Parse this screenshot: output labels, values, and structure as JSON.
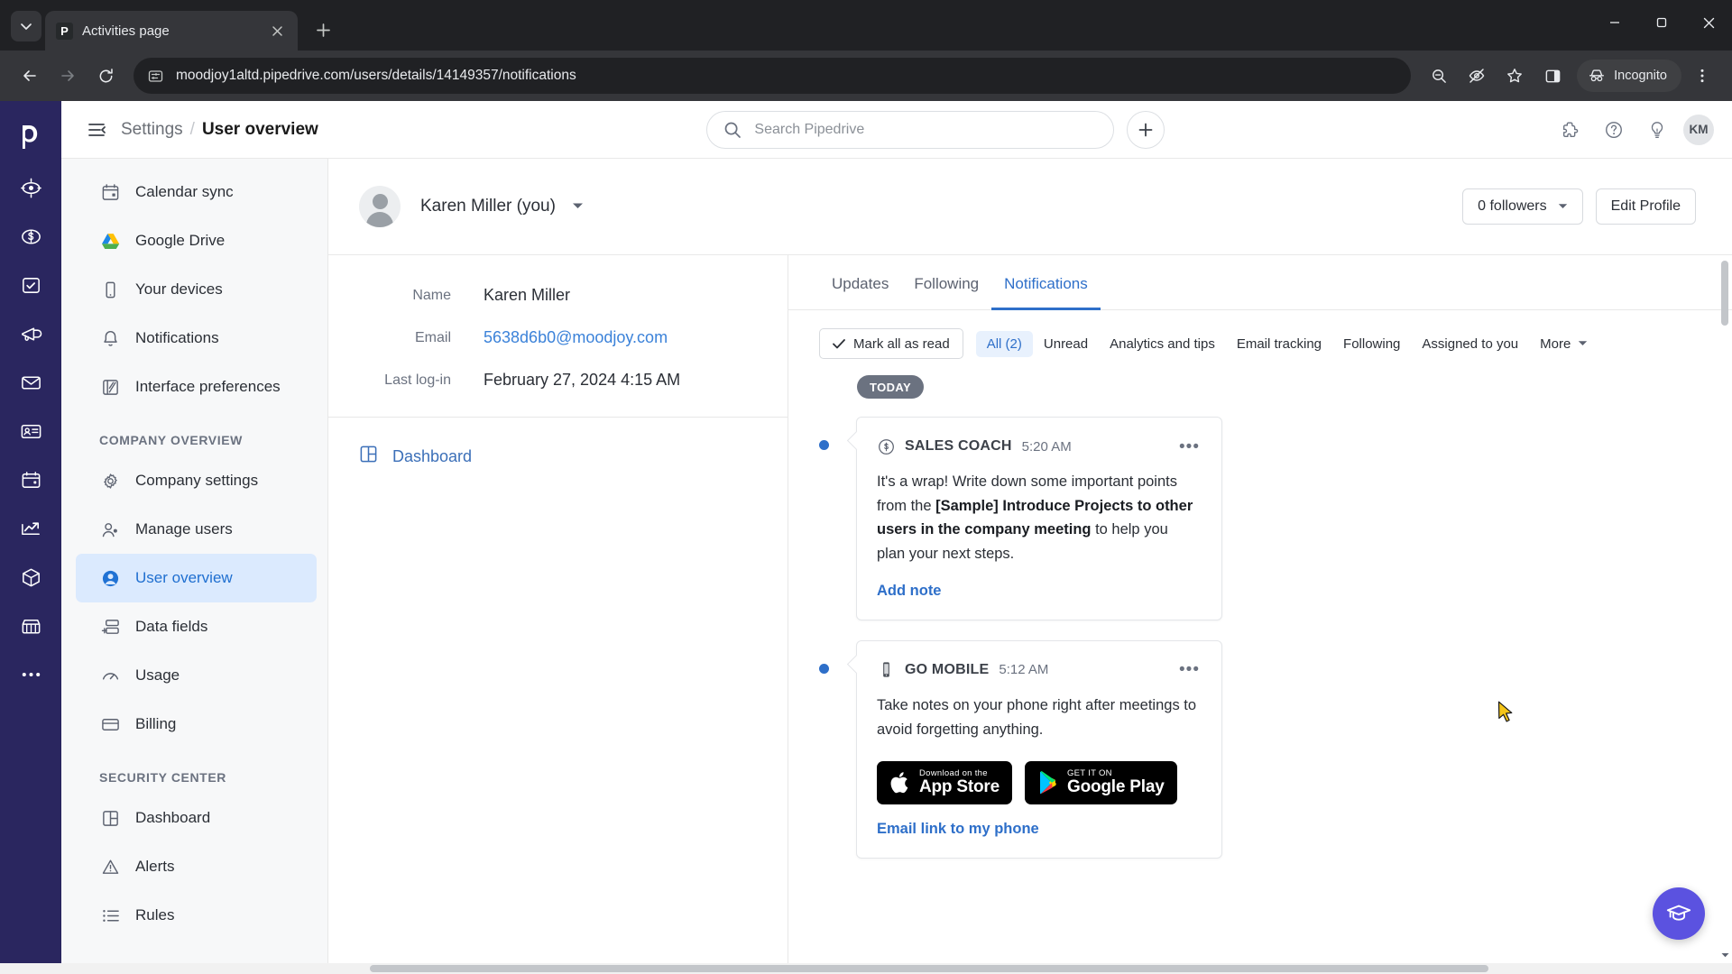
{
  "browser": {
    "tab": {
      "title": "Activities page",
      "favicon_letter": "P"
    },
    "url": "moodjoy1altd.pipedrive.com/users/details/14149357/notifications",
    "profile_label": "Incognito",
    "icons": {
      "tab_search": "tab-search-dropdown-icon",
      "new_tab": "new-tab-icon",
      "minimize": "minimize-icon",
      "maximize": "maximize-icon",
      "close": "close-window-icon",
      "back": "back-icon",
      "forward": "forward-icon",
      "reload": "reload-icon",
      "site_info": "site-settings-icon",
      "zoom_out": "zoom-out-icon",
      "hide_password": "eye-slash-icon",
      "bookmark": "star-icon",
      "side_panel": "side-panel-icon",
      "menu": "three-dot-menu-icon"
    }
  },
  "rail": {
    "logo": "pipedrive-logo",
    "items": [
      {
        "name": "leads-icon"
      },
      {
        "name": "deals-icon"
      },
      {
        "name": "activities-icon"
      },
      {
        "name": "campaigns-icon"
      },
      {
        "name": "mail-icon"
      },
      {
        "name": "contacts-icon"
      },
      {
        "name": "calendar-icon"
      },
      {
        "name": "insights-icon"
      },
      {
        "name": "products-icon"
      },
      {
        "name": "marketplace-icon"
      },
      {
        "name": "more-icon"
      }
    ]
  },
  "topbar": {
    "hamburger": "collapse-menu-icon",
    "breadcrumb_parent": "Settings",
    "breadcrumb_sep": "/",
    "breadcrumb_current": "User overview",
    "search_placeholder": "Search Pipedrive",
    "add_button": "add-new-icon",
    "right_icons": [
      "apps-icon",
      "help-icon",
      "whats-new-icon"
    ],
    "avatar_initials": "KM"
  },
  "settings_nav": {
    "items": [
      {
        "label": "Calendar sync",
        "icon": "calendar-sync-icon",
        "active": false
      },
      {
        "label": "Google Drive",
        "icon": "google-drive-icon",
        "active": false
      },
      {
        "label": "Your devices",
        "icon": "device-icon",
        "active": false
      },
      {
        "label": "Notifications",
        "icon": "bell-icon",
        "active": false
      },
      {
        "label": "Interface preferences",
        "icon": "interface-preferences-icon",
        "active": false
      }
    ],
    "section_company": "COMPANY OVERVIEW",
    "company_items": [
      {
        "label": "Company settings",
        "icon": "gear-icon",
        "active": false
      },
      {
        "label": "Manage users",
        "icon": "users-icon",
        "active": false
      },
      {
        "label": "User overview",
        "icon": "user-circle-icon",
        "active": true
      },
      {
        "label": "Data fields",
        "icon": "data-fields-icon",
        "active": false
      },
      {
        "label": "Usage",
        "icon": "usage-gauge-icon",
        "active": false
      },
      {
        "label": "Billing",
        "icon": "credit-card-icon",
        "active": false
      }
    ],
    "section_security": "SECURITY CENTER",
    "security_items": [
      {
        "label": "Dashboard",
        "icon": "dashboard-grid-icon",
        "active": false
      },
      {
        "label": "Alerts",
        "icon": "warning-triangle-icon",
        "active": false
      },
      {
        "label": "Rules",
        "icon": "list-rules-icon",
        "active": false
      }
    ]
  },
  "profile": {
    "display_name": "Karen Miller (you)",
    "avatar": "user-avatar-placeholder",
    "followers_label": "0 followers",
    "edit_label": "Edit Profile"
  },
  "details": {
    "rows": [
      {
        "label": "Name",
        "value": "Karen Miller",
        "is_link": false
      },
      {
        "label": "Email",
        "value": "5638d6b0@moodjoy.com",
        "is_link": true
      },
      {
        "label": "Last log-in",
        "value": "February 27, 2024 4:15 AM",
        "is_link": false
      }
    ],
    "dashboard_link": "Dashboard"
  },
  "feed": {
    "tabs": [
      {
        "label": "Updates",
        "active": false
      },
      {
        "label": "Following",
        "active": false
      },
      {
        "label": "Notifications",
        "active": true
      }
    ],
    "mark_all_read": "Mark all as read",
    "filters": [
      {
        "label": "All (2)",
        "active": true
      },
      {
        "label": "Unread",
        "active": false
      },
      {
        "label": "Analytics and tips",
        "active": false
      },
      {
        "label": "Email tracking",
        "active": false
      },
      {
        "label": "Following",
        "active": false
      },
      {
        "label": "Assigned to you",
        "active": false
      }
    ],
    "more_label": "More",
    "day_badge": "TODAY",
    "notifications": [
      {
        "source": "SALES COACH",
        "source_icon": "sales-coach-icon",
        "time": "5:20 AM",
        "unread": true,
        "body_pre": "It's a wrap! Write down some important points from the ",
        "body_bold": "[Sample] Introduce Projects to other users in the company meeting",
        "body_post": " to help you plan your next steps.",
        "action": "Add note"
      },
      {
        "source": "GO MOBILE",
        "source_icon": "mobile-phone-icon",
        "time": "5:12 AM",
        "unread": true,
        "body_pre": "Take notes on your phone right after meetings to avoid forgetting anything.",
        "body_bold": "",
        "body_post": "",
        "action": "Email link to my phone",
        "store_badges": [
          {
            "small": "Download on the",
            "big": "App Store",
            "icon": "apple-logo-icon"
          },
          {
            "small": "GET IT ON",
            "big": "Google Play",
            "icon": "google-play-icon"
          }
        ]
      }
    ]
  },
  "fab": {
    "name": "academy-graduation-cap-icon"
  },
  "colors": {
    "rail_bg": "#2a265f",
    "accent_blue": "#2e6fc9",
    "active_nav_bg": "#dbeafe",
    "fab_purple": "#5b52e0",
    "badge_gray": "#6b7280"
  }
}
